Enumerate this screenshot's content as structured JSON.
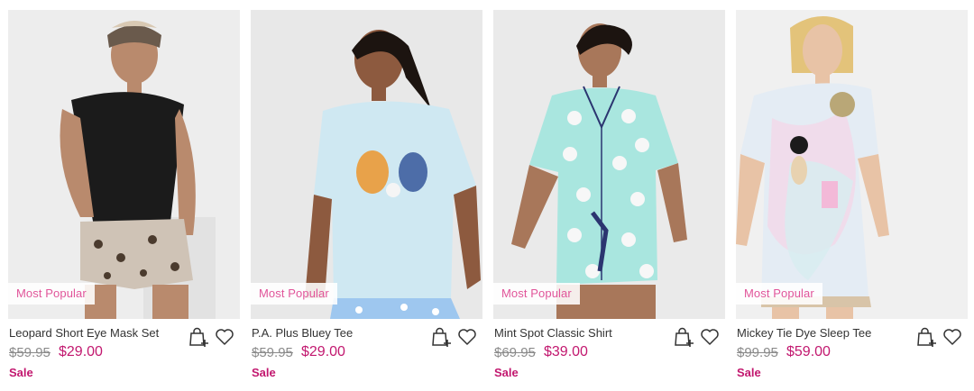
{
  "products": [
    {
      "name": "Leopard Short Eye Mask Set",
      "was_price": "$59.95",
      "price": "$29.00",
      "badge": "Most Popular",
      "sale_label": "Sale",
      "colors": {
        "bg": "#ededed",
        "top": "#1b1b1b",
        "bottom": "#cfc3b6",
        "skin": "#b98a6d"
      }
    },
    {
      "name": "P.A. Plus Bluey Tee",
      "was_price": "$59.95",
      "price": "$29.00",
      "badge": "Most Popular",
      "sale_label": "Sale",
      "colors": {
        "bg": "#e8e8e8",
        "top": "#cfe8f2",
        "bottom": "#9ec7ef",
        "skin": "#8d5a3f"
      }
    },
    {
      "name": "Mint Spot Classic Shirt",
      "was_price": "$69.95",
      "price": "$39.00",
      "badge": "Most Popular",
      "sale_label": "Sale",
      "colors": {
        "bg": "#eaeaea",
        "top": "#a9e6df",
        "bottom": "#a9e6df",
        "skin": "#a8775a"
      }
    },
    {
      "name": "Mickey Tie Dye Sleep Tee",
      "was_price": "$99.95",
      "price": "$59.00",
      "badge": "Most Popular",
      "sale_label": "Sale",
      "colors": {
        "bg": "#f0f0f0",
        "top": "#e4ecf4",
        "bottom": "#f3d8e8",
        "skin": "#e8c3a6"
      }
    }
  ],
  "icons": {
    "bag": "add-to-bag-icon",
    "heart": "wishlist-heart-icon"
  },
  "accent_color": "#c2186f",
  "badge_color": "#e1559a"
}
